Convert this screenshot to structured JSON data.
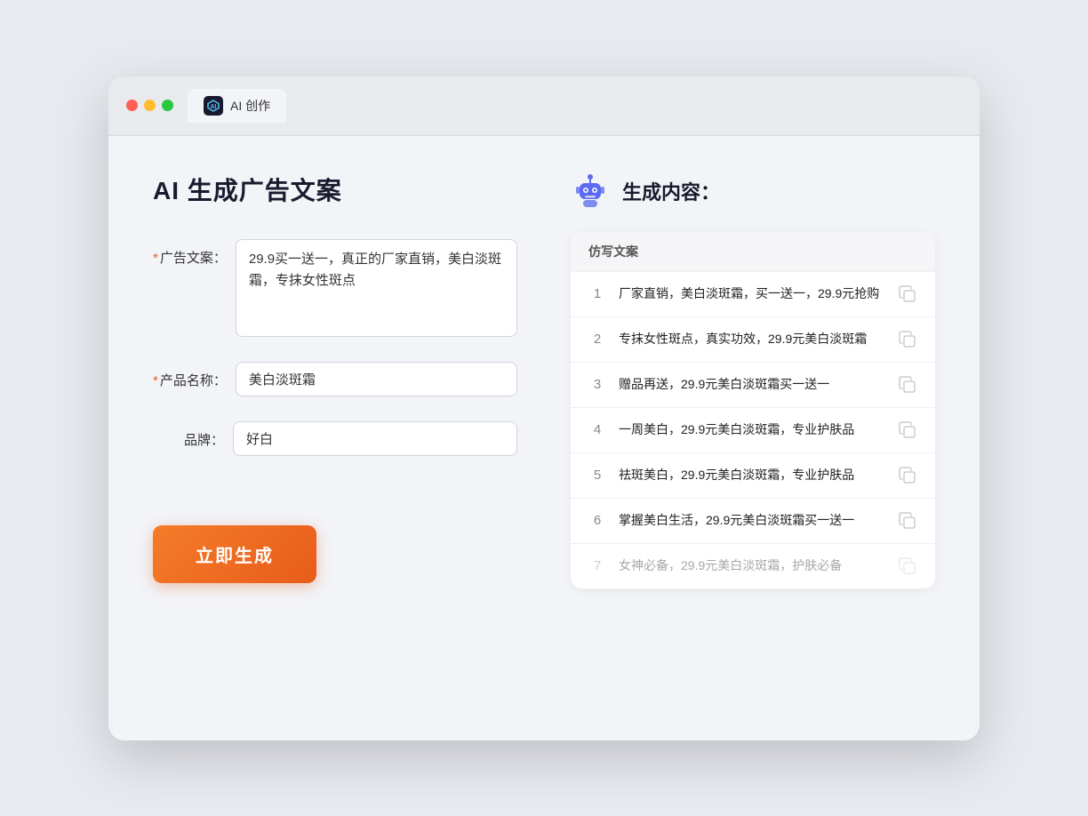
{
  "browser": {
    "tab_label": "AI 创作"
  },
  "left": {
    "page_title": "AI 生成广告文案",
    "ad_label": "广告文案：",
    "ad_placeholder": "29.9买一送一，真正的厂家直销，美白淡斑霜，专抹女性斑点",
    "product_label": "产品名称：",
    "product_value": "美白淡斑霜",
    "brand_label": "品牌：",
    "brand_value": "好白",
    "generate_btn": "立即生成"
  },
  "right": {
    "title": "生成内容：",
    "table_header": "仿写文案",
    "rows": [
      {
        "num": "1",
        "text": "厂家直销，美白淡斑霜，买一送一，29.9元抢购",
        "dimmed": false
      },
      {
        "num": "2",
        "text": "专抹女性斑点，真实功效，29.9元美白淡斑霜",
        "dimmed": false
      },
      {
        "num": "3",
        "text": "赠品再送，29.9元美白淡斑霜买一送一",
        "dimmed": false
      },
      {
        "num": "4",
        "text": "一周美白，29.9元美白淡斑霜，专业护肤品",
        "dimmed": false
      },
      {
        "num": "5",
        "text": "祛斑美白，29.9元美白淡斑霜，专业护肤品",
        "dimmed": false
      },
      {
        "num": "6",
        "text": "掌握美白生活，29.9元美白淡斑霜买一送一",
        "dimmed": false
      },
      {
        "num": "7",
        "text": "女神必备，29.9元美白淡斑霜，护肤必备",
        "dimmed": true
      }
    ]
  }
}
